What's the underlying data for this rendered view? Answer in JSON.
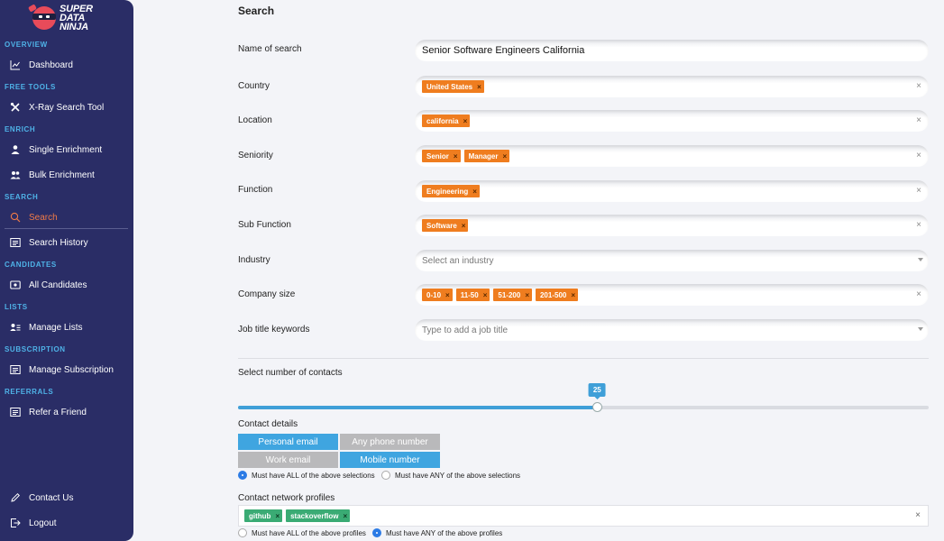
{
  "brand": {
    "line1": "SUPER",
    "line2": "DATA",
    "line3": "NINJA"
  },
  "sidebar": {
    "sections": {
      "overview": "OVERVIEW",
      "free_tools": "FREE TOOLS",
      "enrich": "ENRICH",
      "search": "SEARCH",
      "candidates": "CANDIDATES",
      "lists": "LISTS",
      "subscription": "SUBSCRIPTION",
      "referrals": "REFERRALS"
    },
    "items": {
      "dashboard": "Dashboard",
      "xray": "X-Ray Search Tool",
      "single": "Single Enrichment",
      "bulk": "Bulk Enrichment",
      "search": "Search",
      "history": "Search History",
      "candidates": "All Candidates",
      "lists": "Manage Lists",
      "subscription": "Manage Subscription",
      "refer": "Refer a Friend",
      "contact": "Contact Us",
      "logout": "Logout"
    },
    "active_item": "Search",
    "active_color": "#ef7a47",
    "section_color": "#4fb3e8",
    "bg_color": "#2a2d66"
  },
  "page_title": "Search",
  "form": {
    "name": {
      "label": "Name of search",
      "value": "Senior Software Engineers California"
    },
    "country": {
      "label": "Country",
      "tags": [
        "United States"
      ]
    },
    "location": {
      "label": "Location",
      "tags": [
        "california"
      ]
    },
    "seniority": {
      "label": "Seniority",
      "tags": [
        "Senior",
        "Manager"
      ]
    },
    "function": {
      "label": "Function",
      "tags": [
        "Engineering"
      ]
    },
    "sub_function": {
      "label": "Sub Function",
      "tags": [
        "Software"
      ]
    },
    "industry": {
      "label": "Industry",
      "placeholder": "Select an industry"
    },
    "company_size": {
      "label": "Company size",
      "tags": [
        "0-10",
        "11-50",
        "51-200",
        "201-500"
      ]
    },
    "job_title": {
      "label": "Job title keywords",
      "placeholder": "Type to add a job title"
    },
    "clear_symbol": "×",
    "tag_remove_symbol": "×"
  },
  "contacts_slider": {
    "label": "Select number of contacts",
    "value": "25",
    "fraction": 0.52
  },
  "contact_details": {
    "label": "Contact details",
    "buttons": [
      {
        "label": "Personal email",
        "selected": true
      },
      {
        "label": "Any phone number",
        "selected": false
      },
      {
        "label": "Work email",
        "selected": false
      },
      {
        "label": "Mobile number",
        "selected": true
      }
    ],
    "radio_all": "Must have ALL of the above selections",
    "radio_any": "Must have ANY of the above selections",
    "selected_radio": "all"
  },
  "network_profiles": {
    "label": "Contact network profiles",
    "tags": [
      "github",
      "stackoverflow"
    ],
    "radio_all": "Must have ALL of the above profiles",
    "radio_any": "Must have ANY of the above profiles",
    "selected_radio": "any"
  },
  "colors": {
    "tag_orange": "#ef7d1f",
    "tag_green": "#3aab74",
    "accent_blue": "#3fa5e0"
  },
  "icons": {
    "dashboard": "chart-line-icon",
    "xray": "tools-icon",
    "single": "user-icon",
    "bulk": "users-icon",
    "search": "search-icon",
    "history": "list-icon",
    "candidates": "id-card-icon",
    "lists": "user-list-icon",
    "subscription": "list-icon",
    "refer": "list-icon",
    "contact": "pencil-icon",
    "logout": "logout-icon"
  }
}
